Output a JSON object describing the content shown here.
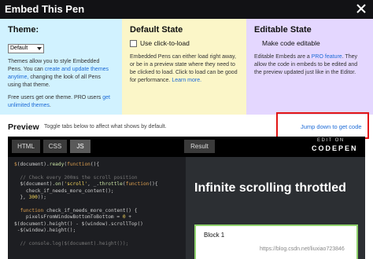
{
  "modal": {
    "title": "Embed This Pen"
  },
  "theme": {
    "heading": "Theme:",
    "select_value": "Default",
    "p1_pre": "Themes allow you to style Embedded Pens. You can ",
    "p1_link": "create and update themes anytime,",
    "p1_post": " changing the look of all Pens using that theme.",
    "p2_pre": "Free users get one theme. PRO users ",
    "p2_link": "get unlimited themes",
    "p2_post": "."
  },
  "default_state": {
    "heading": "Default State",
    "checkbox_label": "Use click-to-load",
    "desc_pre": "Embedded Pens can either load right away, or be in a preview state where they need to be clicked to load. Click to load can be good for performance. ",
    "desc_link": "Learn more."
  },
  "editable_state": {
    "heading": "Editable State",
    "checkbox_label": "Make code editable",
    "desc_pre": "Editable Embeds are a ",
    "desc_link": "PRO feature",
    "desc_post": ". They allow the code in embeds to be edited and the preview updated just like in the Editor."
  },
  "preview": {
    "title": "Preview",
    "hint": "Toggle tabs below to affect what shows by default.",
    "jump_link": "Jump down to get code"
  },
  "embed": {
    "tabs": [
      "HTML",
      "CSS",
      "JS"
    ],
    "result_tab": "Result",
    "edit_on": "EDIT ON",
    "codepen": "CODEPEN"
  },
  "code_lines": [
    {
      "segs": [
        [
          "k",
          "$"
        ],
        [
          "",
          "(document)."
        ],
        [
          "f",
          "ready"
        ],
        [
          "",
          "("
        ],
        [
          "k",
          "function"
        ],
        [
          "",
          "(){"
        ]
      ]
    },
    {
      "segs": []
    },
    {
      "segs": [
        [
          "c",
          "  // Check every 200ms the scroll position"
        ]
      ]
    },
    {
      "segs": [
        [
          "",
          "  $(document)."
        ],
        [
          "f",
          "on"
        ],
        [
          "",
          "("
        ],
        [
          "s",
          "'scroll'"
        ],
        [
          "",
          ", _."
        ],
        [
          "f",
          "throttle"
        ],
        [
          "",
          "("
        ],
        [
          "k",
          "function"
        ],
        [
          "",
          "(){"
        ]
      ]
    },
    {
      "segs": [
        [
          "",
          "    check_if_needs_more_content();"
        ]
      ]
    },
    {
      "segs": [
        [
          "",
          "  }, "
        ],
        [
          "s",
          "300"
        ],
        [
          "",
          "));"
        ]
      ]
    },
    {
      "segs": []
    },
    {
      "segs": [
        [
          "",
          "  "
        ],
        [
          "k",
          "function"
        ],
        [
          "",
          " check_if_needs_more_content() {"
        ]
      ]
    },
    {
      "segs": [
        [
          "",
          "    pixelsFromWindowBottomToBottom = "
        ],
        [
          "s",
          "0"
        ],
        [
          "",
          " +"
        ]
      ]
    },
    {
      "segs": [
        [
          "",
          "$(document).height() - $(window).scrollTop()"
        ]
      ]
    },
    {
      "segs": [
        [
          "",
          " -$(window).height();"
        ]
      ]
    },
    {
      "segs": []
    },
    {
      "segs": [
        [
          "c",
          "  // console.log($(document).height());"
        ]
      ]
    }
  ],
  "result": {
    "heading": "Infinite scrolling throttled",
    "block_label": "Block 1"
  },
  "watermark": "https://blog.csdn.net/liuxiao723846"
}
